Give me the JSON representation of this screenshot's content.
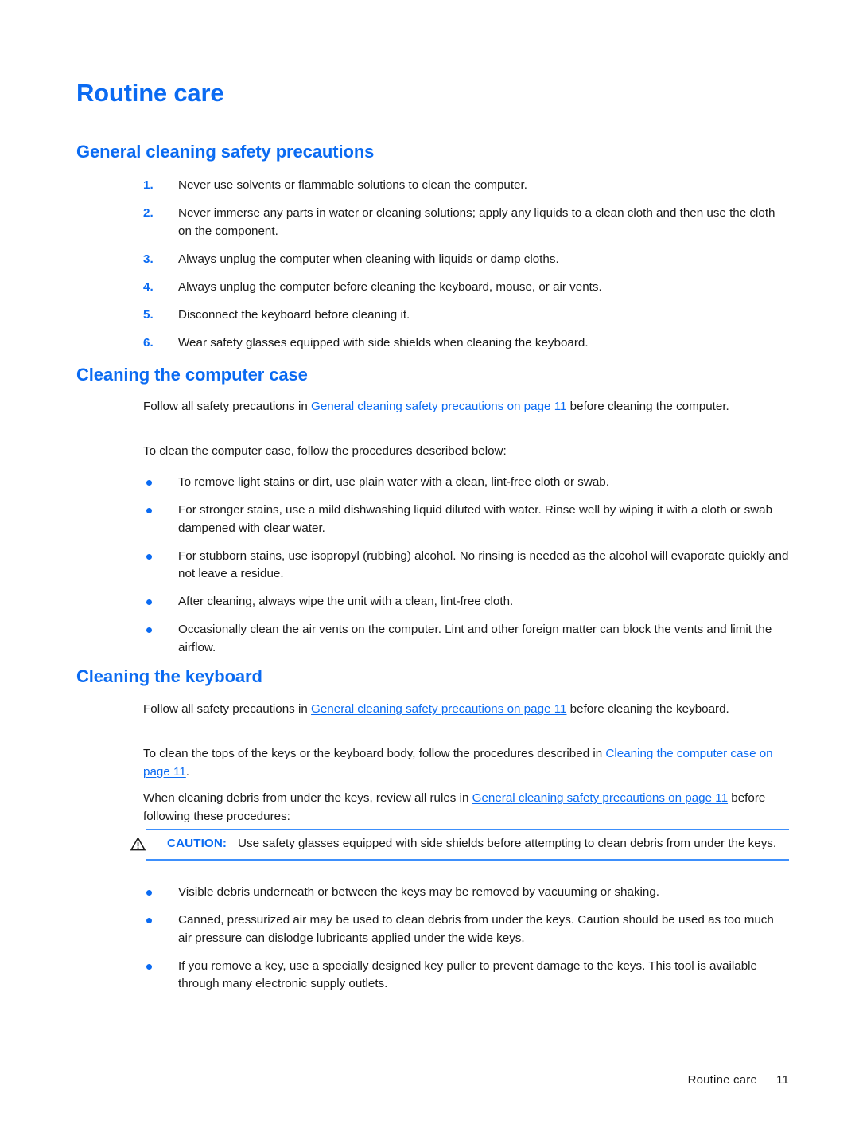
{
  "document": {
    "title": "Routine care",
    "page_number": "11"
  },
  "sections": {
    "general": {
      "heading": "General cleaning safety precautions",
      "steps": [
        {
          "number": "1.",
          "text": "Never use solvents or flammable solutions to clean the computer."
        },
        {
          "number": "2.",
          "text": "Never immerse any parts in water or cleaning solutions; apply any liquids to a clean cloth and then use the cloth on the component."
        },
        {
          "number": "3.",
          "text": "Always unplug the computer when cleaning with liquids or damp cloths."
        },
        {
          "number": "4.",
          "text": "Always unplug the computer before cleaning the keyboard, mouse, or air vents."
        },
        {
          "number": "5.",
          "text": "Disconnect the keyboard before cleaning it."
        },
        {
          "number": "6.",
          "text": "Wear safety glasses equipped with side shields when cleaning the keyboard."
        }
      ]
    },
    "computer_case": {
      "heading": "Cleaning the computer case",
      "intro_before_link": "Follow all safety precautions in ",
      "intro_link": "General cleaning safety precautions on page 11",
      "intro_after_link": " before cleaning the computer.",
      "procedures_lead": "To clean the computer case, follow the procedures described below:",
      "bullets": [
        "To remove light stains or dirt, use plain water with a clean, lint-free cloth or swab.",
        "For stronger stains, use a mild dishwashing liquid diluted with water. Rinse well by wiping it with a cloth or swab dampened with clear water.",
        "For stubborn stains, use isopropyl (rubbing) alcohol. No rinsing is needed as the alcohol will evaporate quickly and not leave a residue.",
        "After cleaning, always wipe the unit with a clean, lint-free cloth.",
        "Occasionally clean the air vents on the computer. Lint and other foreign matter can block the vents and limit the airflow."
      ]
    },
    "keyboard": {
      "heading": "Cleaning the keyboard",
      "intro_before_link": "Follow all safety precautions in ",
      "intro_link": "General cleaning safety precautions on page 11",
      "intro_after_link": " before cleaning the keyboard.",
      "tops_before_link": "To clean the tops of the keys or the keyboard body, follow the procedures described in ",
      "tops_link": "Cleaning the computer case on page 11",
      "tops_after_link": ".",
      "debris_before_link": "When cleaning debris from under the keys, review all rules in ",
      "debris_link": "General cleaning safety precautions on page 11",
      "debris_after_link": " before following these procedures:",
      "caution": {
        "icon": "warning-triangle-icon",
        "label": "CAUTION:",
        "text": "Use safety glasses equipped with side shields before attempting to clean debris from under the keys."
      },
      "bullets": [
        "Visible debris underneath or between the keys may be removed by vacuuming or shaking.",
        "Canned, pressurized air may be used to clean debris from under the keys. Caution should be used as too much air pressure can dislodge lubricants applied under the wide keys.",
        "If you remove a key, use a specially designed key puller to prevent damage to the keys. This tool is available through many electronic supply outlets."
      ]
    }
  },
  "colors": {
    "accent_blue": "#0b6bf2",
    "rule_blue": "#3d8ffc",
    "body_text": "#1a1a1a"
  }
}
